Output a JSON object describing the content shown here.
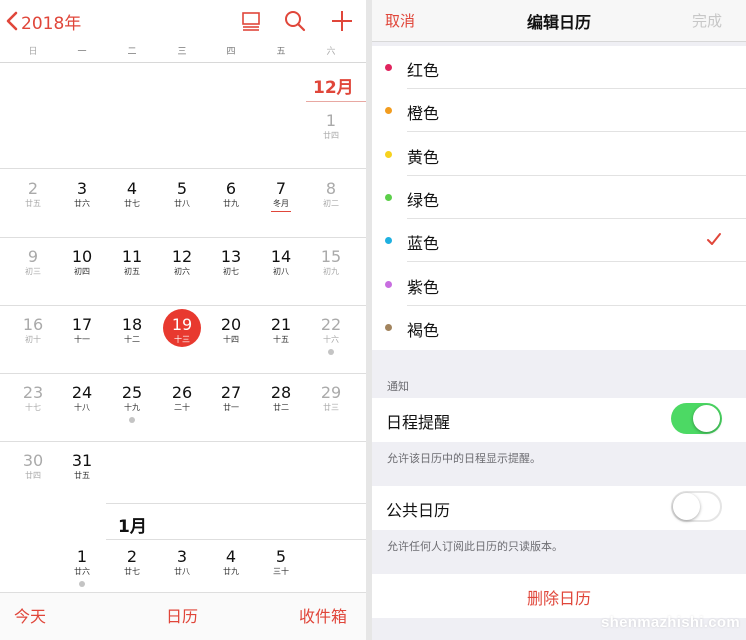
{
  "calendar": {
    "year_back_label": "2018年",
    "weekdays": [
      "日",
      "一",
      "二",
      "三",
      "四",
      "五",
      "六"
    ],
    "months": [
      {
        "label": "12月",
        "weeks": [
          [
            null,
            null,
            null,
            null,
            null,
            null,
            {
              "n": "1",
              "l": "廿四"
            }
          ],
          [
            {
              "n": "2",
              "l": "廿五"
            },
            {
              "n": "3",
              "l": "廿六"
            },
            {
              "n": "4",
              "l": "廿七"
            },
            {
              "n": "5",
              "l": "廿八"
            },
            {
              "n": "6",
              "l": "廿九"
            },
            {
              "n": "7",
              "l": "冬月"
            },
            {
              "n": "8",
              "l": "初二"
            }
          ],
          [
            {
              "n": "9",
              "l": "初三"
            },
            {
              "n": "10",
              "l": "初四"
            },
            {
              "n": "11",
              "l": "初五"
            },
            {
              "n": "12",
              "l": "初六"
            },
            {
              "n": "13",
              "l": "初七"
            },
            {
              "n": "14",
              "l": "初八"
            },
            {
              "n": "15",
              "l": "初九"
            }
          ],
          [
            {
              "n": "16",
              "l": "初十"
            },
            {
              "n": "17",
              "l": "十一"
            },
            {
              "n": "18",
              "l": "十二"
            },
            {
              "n": "19",
              "l": "十三"
            },
            {
              "n": "20",
              "l": "十四"
            },
            {
              "n": "21",
              "l": "十五"
            },
            {
              "n": "22",
              "l": "十六"
            }
          ],
          [
            {
              "n": "23",
              "l": "十七"
            },
            {
              "n": "24",
              "l": "十八"
            },
            {
              "n": "25",
              "l": "十九"
            },
            {
              "n": "26",
              "l": "二十"
            },
            {
              "n": "27",
              "l": "廿一"
            },
            {
              "n": "28",
              "l": "廿二"
            },
            {
              "n": "29",
              "l": "廿三"
            }
          ],
          [
            {
              "n": "30",
              "l": "廿四"
            },
            {
              "n": "31",
              "l": "廿五"
            },
            null,
            null,
            null,
            null,
            null
          ]
        ]
      },
      {
        "label": "1月",
        "weeks": [
          [
            null,
            {
              "n": "1",
              "l": "廿六"
            },
            {
              "n": "2",
              "l": "廿七"
            },
            {
              "n": "3",
              "l": "廿八"
            },
            {
              "n": "4",
              "l": "廿九"
            },
            {
              "n": "5",
              "l": "三十"
            },
            null
          ]
        ]
      }
    ],
    "today": "19",
    "month_start_marker": "7",
    "event_dots": [
      "22",
      "25",
      "1"
    ],
    "toolbar": {
      "today": "今天",
      "calendars": "日历",
      "inbox": "收件箱"
    },
    "accent_color": "#e0463a"
  },
  "edit": {
    "cancel": "取消",
    "title": "编辑日历",
    "done": "完成",
    "colors": [
      {
        "label": "红色",
        "color": "#e0245e"
      },
      {
        "label": "橙色",
        "color": "#f29c1f"
      },
      {
        "label": "黄色",
        "color": "#f7d21e"
      },
      {
        "label": "绿色",
        "color": "#5ccf4a"
      },
      {
        "label": "蓝色",
        "color": "#1fb0e0",
        "selected": true
      },
      {
        "label": "紫色",
        "color": "#c86ee0"
      },
      {
        "label": "褐色",
        "color": "#a2845e"
      }
    ],
    "notify_header": "通知",
    "event_alerts": {
      "label": "日程提醒",
      "on": true,
      "footer": "允许该日历中的日程显示提醒。"
    },
    "public_calendar": {
      "label": "公共日历",
      "on": false,
      "footer": "允许任何人订阅此日历的只读版本。"
    },
    "delete_label": "删除日历",
    "toggle_on_color": "#4cd964"
  },
  "watermark": "shenmazhishi.com"
}
